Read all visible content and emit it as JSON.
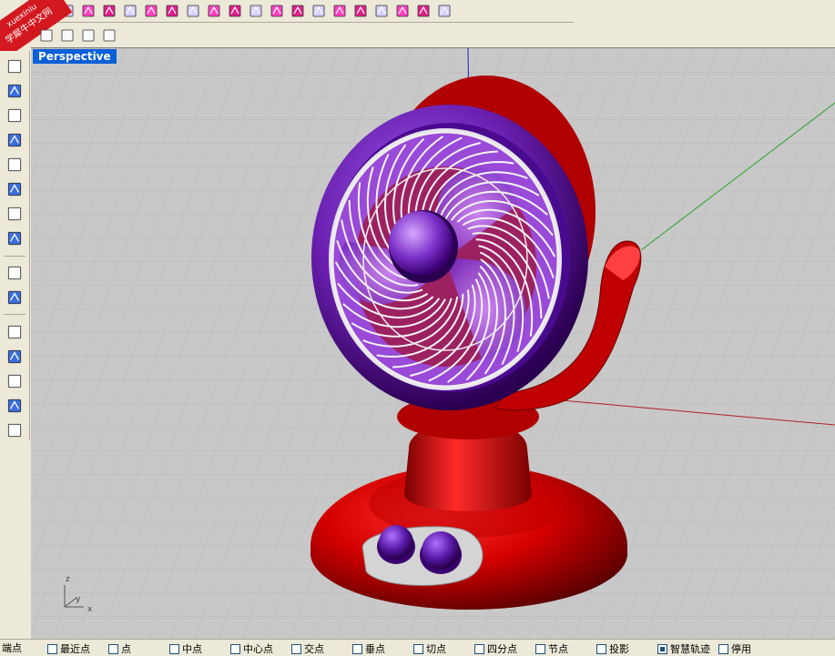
{
  "watermark": {
    "line1": "xuexiniu",
    "line2": "学犀牛中文网"
  },
  "viewport": {
    "title": "Perspective",
    "axis_labels": {
      "z": "z",
      "y": "y",
      "x": "x"
    }
  },
  "status_bar": {
    "first_label": "端点",
    "osnaps": [
      {
        "label": "最近点",
        "checked": false
      },
      {
        "label": "点",
        "checked": false
      },
      {
        "label": "中点",
        "checked": false
      },
      {
        "label": "中心点",
        "checked": false
      },
      {
        "label": "交点",
        "checked": false
      },
      {
        "label": "垂点",
        "checked": false
      },
      {
        "label": "切点",
        "checked": false
      },
      {
        "label": "四分点",
        "checked": false
      },
      {
        "label": "节点",
        "checked": false
      },
      {
        "label": "投影",
        "checked": false
      },
      {
        "label": "智慧轨迹",
        "checked": true
      },
      {
        "label": "停用",
        "checked": false
      }
    ]
  },
  "colors": {
    "fan_body_red": "#d40000",
    "fan_ring_purple": "#6a1fb0",
    "viewport_bg": "#c8c8c8",
    "title_blue": "#0a5fd8",
    "axis_green": "#2aa02a",
    "axis_red": "#b02020",
    "axis_blue": "#2020c0"
  },
  "toolbar_icons": [
    "new-file-icon",
    "save-icon",
    "print-icon",
    "open-icon",
    "surface-icon",
    "extrude-icon",
    "box-icon",
    "solid-icon",
    "rotate-icon",
    "sweep-icon",
    "cube-icon",
    "axes-icon",
    "curve-icon",
    "edit-points-icon",
    "explode-icon",
    "grid-icon",
    "split-icon",
    "trim-icon",
    "shade-icon",
    "frame-icon"
  ],
  "view_icons": [
    "view-top-icon",
    "view-front-icon",
    "view-right-icon",
    "view-perspective-icon"
  ],
  "left_tools": [
    "point-icon",
    "polyline-icon",
    "circle-icon",
    "rectangle-icon",
    "arc-icon",
    "surface-tool-icon",
    "solid-spheres-icon",
    "mesh-icon",
    "transform-icon",
    "dimension-icon",
    "array-icon",
    "curve-edit-icon",
    "scale-icon",
    "analyze-icon",
    "layout-icon"
  ]
}
